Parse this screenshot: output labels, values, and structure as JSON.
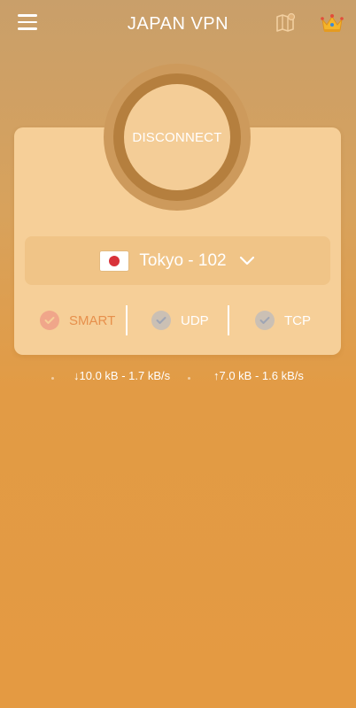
{
  "header": {
    "title": "JAPAN VPN",
    "menu_icon": "hamburger-menu-icon",
    "map_icon": "map-icon",
    "premium_icon": "crown-icon"
  },
  "connection": {
    "button_label": "DISCONNECT"
  },
  "server": {
    "flag": "japan-flag-icon",
    "name": "Tokyo - 102",
    "dropdown_icon": "chevron-down-icon"
  },
  "protocols": [
    {
      "label": "SMART",
      "selected": true
    },
    {
      "label": "UDP",
      "selected": false
    },
    {
      "label": "TCP",
      "selected": false
    }
  ],
  "stats": {
    "download": "↓10.0 kB - 1.7 kB/s",
    "upload": "↑7.0 kB - 1.6 kB/s"
  },
  "colors": {
    "background_top": "#c99f6a",
    "background_bottom": "#e49a42",
    "card": "#f6cf98",
    "accent_selected": "#e7904c",
    "flag_red": "#d8323a"
  }
}
